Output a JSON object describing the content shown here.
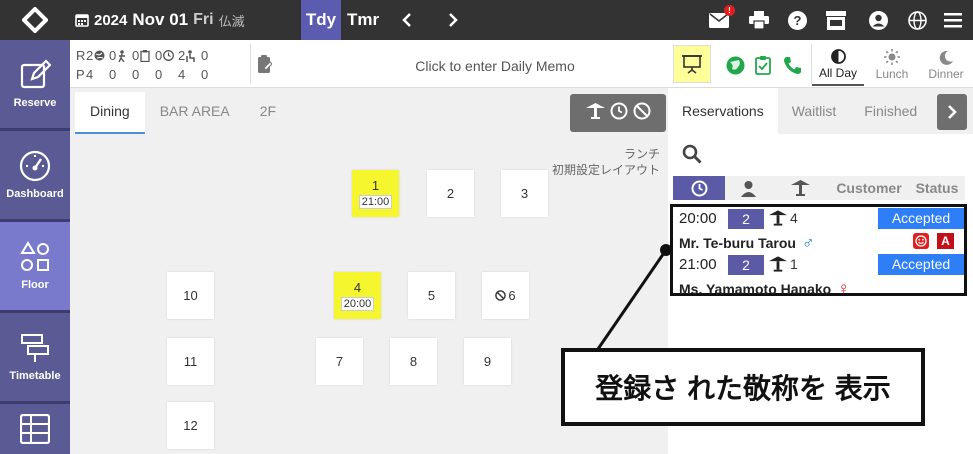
{
  "header": {
    "year": "2024",
    "month_day": "Nov 01",
    "weekday": "Fri",
    "rokuyo": "仏滅",
    "today_label": "Tdy",
    "tomorrow_label": "Tmr",
    "mail_badge": "!"
  },
  "sidebar": {
    "items": [
      {
        "label": "Reserve"
      },
      {
        "label": "Dashboard"
      },
      {
        "label": "Floor"
      },
      {
        "label": "Timetable"
      }
    ]
  },
  "stats": {
    "rows": [
      {
        "label": "R",
        "values": [
          "2",
          "0",
          "0",
          "0",
          "2",
          "0"
        ]
      },
      {
        "label": "P",
        "values": [
          "4",
          "0",
          "0",
          "0",
          "4",
          "0"
        ]
      }
    ]
  },
  "memo": {
    "placeholder": "Click to enter Daily Memo"
  },
  "meals": [
    {
      "label": "All Day"
    },
    {
      "label": "Lunch"
    },
    {
      "label": "Dinner"
    }
  ],
  "floor": {
    "tabs": [
      "Dining",
      "BAR AREA",
      "2F"
    ],
    "layout_label_line1": "ランチ",
    "layout_label_line2": "初期設定レイアウト",
    "tables": [
      {
        "id": "1",
        "time": "21:00"
      },
      {
        "id": "2"
      },
      {
        "id": "3"
      },
      {
        "id": "10"
      },
      {
        "id": "4",
        "time": "20:00"
      },
      {
        "id": "5"
      },
      {
        "id": "6"
      },
      {
        "id": "11"
      },
      {
        "id": "7"
      },
      {
        "id": "8"
      },
      {
        "id": "9"
      },
      {
        "id": "12"
      }
    ]
  },
  "panel": {
    "tabs": [
      "Reservations",
      "Waitlist",
      "Finished"
    ],
    "columns": {
      "customer": "Customer",
      "status": "Status"
    },
    "reservations": [
      {
        "time": "20:00",
        "party": "2",
        "table": "4",
        "status": "Accepted",
        "name": "Mr. Te-buru Tarou",
        "gender": "♂",
        "gender_color": "#1e7fd8",
        "tag_a": "A"
      },
      {
        "time": "21:00",
        "party": "2",
        "table": "1",
        "status": "Accepted",
        "name": "Ms. Yamamoto Hanako",
        "gender": "♀",
        "gender_color": "#e0202a"
      }
    ]
  },
  "callout": {
    "text": "登録さ れた敬称を 表示"
  }
}
